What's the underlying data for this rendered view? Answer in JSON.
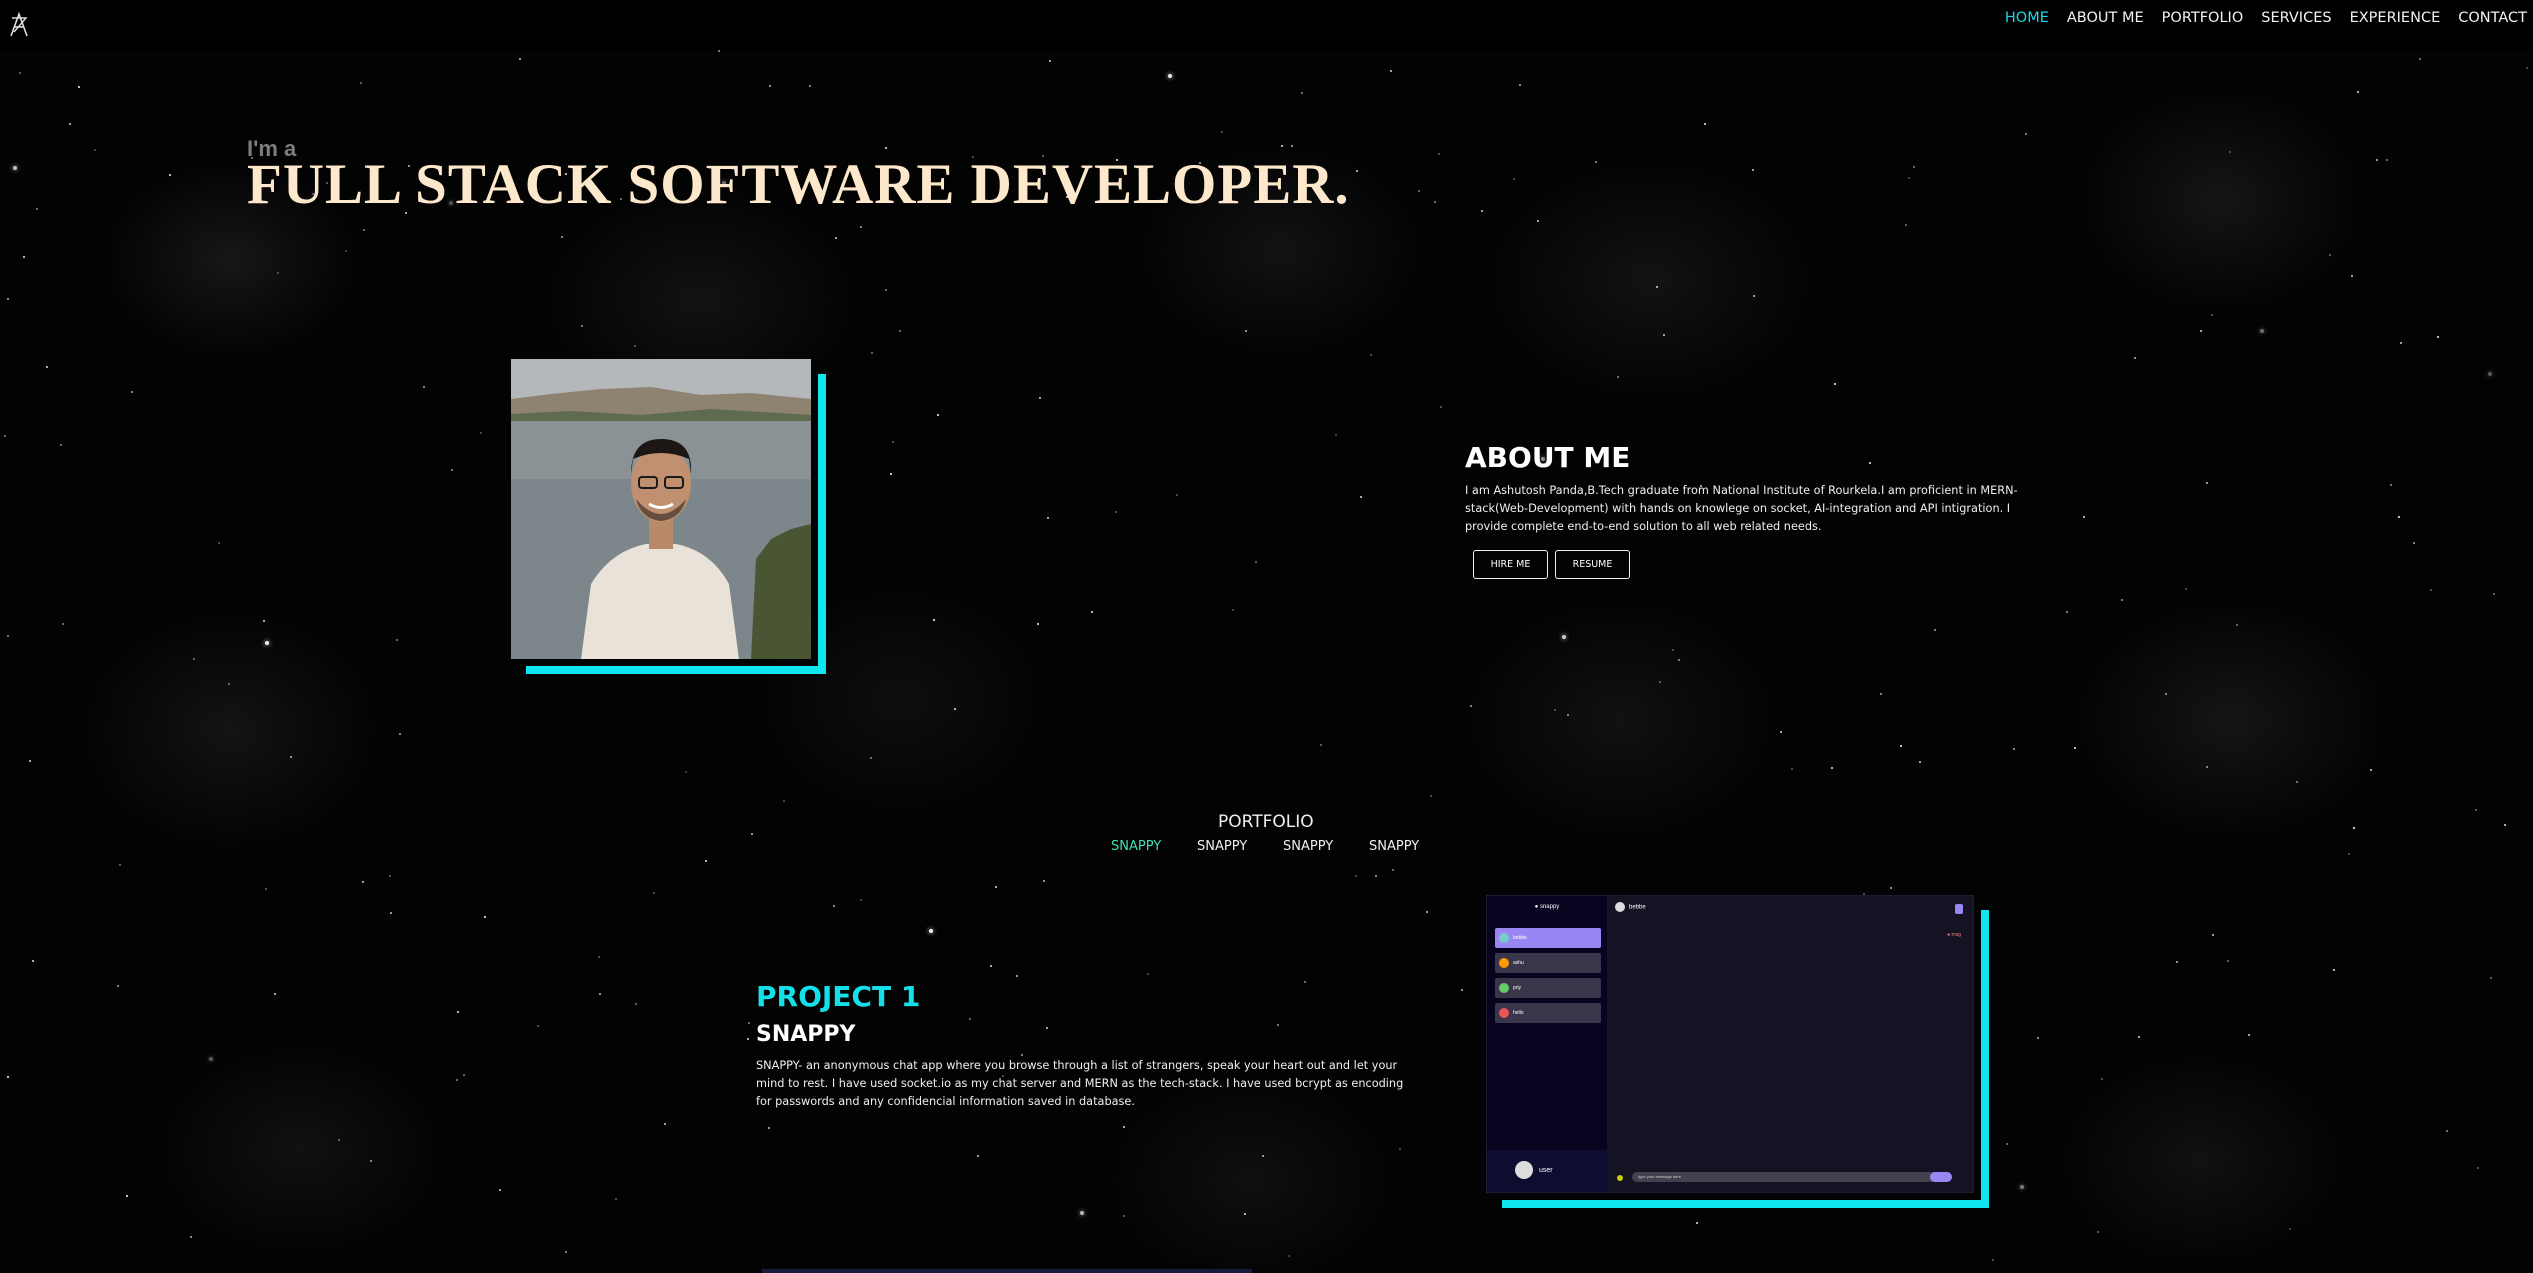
{
  "nav": {
    "logo_icon": "stylized-A-logo-icon",
    "links": [
      {
        "label": "HOME",
        "active": true
      },
      {
        "label": "ABOUT ME",
        "active": false
      },
      {
        "label": "PORTFOLIO",
        "active": false
      },
      {
        "label": "SERVICES",
        "active": false
      },
      {
        "label": "EXPERIENCE",
        "active": false
      },
      {
        "label": "CONTACT",
        "active": false
      }
    ]
  },
  "hero": {
    "intro": "I'm a",
    "title": "FULL STACK SOFTWARE DEVELOPER."
  },
  "about": {
    "title": "ABOUT ME",
    "text": "I am Ashutosh Panda,B.Tech graduate from National Institute of Rourkela.I am proficient in MERN-stack(Web-Development) with hands on knowlege on socket, AI-integration and API intigration. I provide complete end-to-end solution to all web related needs.",
    "hire_label": "HIRE ME",
    "resume_label": "RESUME"
  },
  "portfolio": {
    "title": "PORTFOLIO",
    "tabs": [
      "SNAPPY",
      "SNAPPY",
      "SNAPPY",
      "SNAPPY"
    ],
    "active_tab": 0,
    "project_number": "PROJECT 1",
    "project_name": "SNAPPY",
    "project_description": "SNAPPY- an anonymous chat app where you browse through a list of strangers, speak your heart out and let your mind to rest. I have used socket.io as my chat server and MERN as the tech-stack. I have used bcrypt as encoding for passwords and any confidencial information saved in database."
  },
  "colors": {
    "accent_cyan": "#10e6ef",
    "nav_active": "#1fd8e6",
    "hero_text": "#fde8cc",
    "tab_active": "#3fe0b4",
    "snappy_purple": "#9a86f3"
  }
}
